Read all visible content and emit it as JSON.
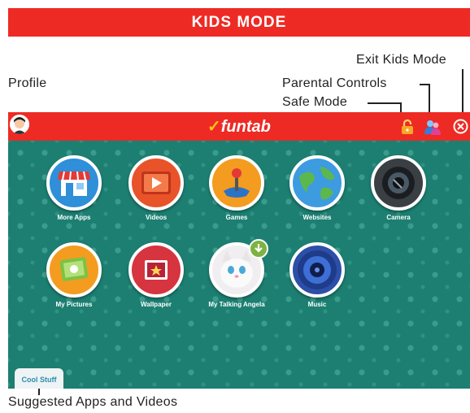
{
  "banner": {
    "title": "KIDS MODE"
  },
  "callouts": {
    "exit": "Exit Kids Mode",
    "profile": "Profile",
    "parental": "Parental Controls",
    "safe": "Safe Mode",
    "suggested": "Suggested Apps and Videos"
  },
  "app": {
    "logo": "funtab",
    "icons": {
      "profile": "avatar-icon",
      "safe": "lock-icon",
      "parental": "parents-icon",
      "exit": "close-icon"
    },
    "colors": {
      "topbar": "#ee2a24",
      "background": "#1c7f72",
      "accent": "#ffc21a"
    },
    "tiles": [
      {
        "label": "More Apps",
        "icon": "store-icon"
      },
      {
        "label": "Videos",
        "icon": "video-icon"
      },
      {
        "label": "Games",
        "icon": "joystick-icon"
      },
      {
        "label": "Websites",
        "icon": "globe-icon"
      },
      {
        "label": "Camera",
        "icon": "camera-icon"
      },
      {
        "label": "My Pictures",
        "icon": "pictures-icon"
      },
      {
        "label": "Wallpaper",
        "icon": "wallpaper-icon"
      },
      {
        "label": "My Talking Angela",
        "icon": "angela-icon"
      },
      {
        "label": "Music",
        "icon": "speaker-icon"
      }
    ],
    "cool_stuff": "Cool Stuff"
  }
}
